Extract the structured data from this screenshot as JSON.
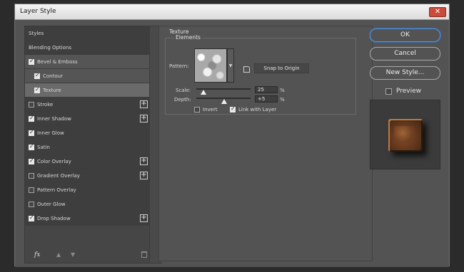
{
  "window": {
    "title": "Layer Style",
    "close_glyph": "✕"
  },
  "styles_list": [
    {
      "label": "Styles",
      "kind": "header",
      "checked": null,
      "plus": false,
      "shade": "dark"
    },
    {
      "label": "Blending Options",
      "kind": "header",
      "checked": null,
      "plus": false,
      "shade": "dark"
    },
    {
      "label": "Bevel & Emboss",
      "kind": "item",
      "checked": true,
      "plus": false,
      "shade": "grey"
    },
    {
      "label": "Contour",
      "kind": "sub",
      "checked": true,
      "plus": false,
      "shade": "grey"
    },
    {
      "label": "Texture",
      "kind": "sub",
      "checked": true,
      "plus": false,
      "shade": "selected"
    },
    {
      "label": "Stroke",
      "kind": "item",
      "checked": false,
      "plus": true,
      "shade": "dark"
    },
    {
      "label": "Inner Shadow",
      "kind": "item",
      "checked": true,
      "plus": true,
      "shade": "dark"
    },
    {
      "label": "Inner Glow",
      "kind": "item",
      "checked": true,
      "plus": false,
      "shade": "dark"
    },
    {
      "label": "Satin",
      "kind": "item",
      "checked": true,
      "plus": false,
      "shade": "dark"
    },
    {
      "label": "Color Overlay",
      "kind": "item",
      "checked": true,
      "plus": true,
      "shade": "dark"
    },
    {
      "label": "Gradient Overlay",
      "kind": "item",
      "checked": false,
      "plus": true,
      "shade": "dark"
    },
    {
      "label": "Pattern Overlay",
      "kind": "item",
      "checked": false,
      "plus": false,
      "shade": "dark"
    },
    {
      "label": "Outer Glow",
      "kind": "item",
      "checked": false,
      "plus": false,
      "shade": "dark"
    },
    {
      "label": "Drop Shadow",
      "kind": "item",
      "checked": true,
      "plus": true,
      "shade": "dark"
    }
  ],
  "footer": {
    "fx_label": "fx",
    "up_glyph": "▲",
    "down_glyph": "▼",
    "icons": [
      "fx-icon",
      "move-up-icon",
      "move-down-icon",
      "trash-icon"
    ]
  },
  "texture": {
    "group_title": "Texture",
    "elements_title": "Elements",
    "pattern_label": "Pattern:",
    "snap_button": "Snap to Origin",
    "scale_label": "Scale:",
    "scale_value": "25",
    "scale_unit": "%",
    "depth_label": "Depth:",
    "depth_value": "+5",
    "depth_unit": "%",
    "invert_label": "Invert",
    "invert_checked": false,
    "link_label": "Link with Layer",
    "link_checked": true
  },
  "buttons": {
    "ok": "OK",
    "cancel": "Cancel",
    "new_style": "New Style...",
    "preview": "Preview",
    "preview_checked": false
  },
  "colors": {
    "panel": "#535353",
    "accent": "#5a8fd0",
    "close": "#c94b3c"
  }
}
